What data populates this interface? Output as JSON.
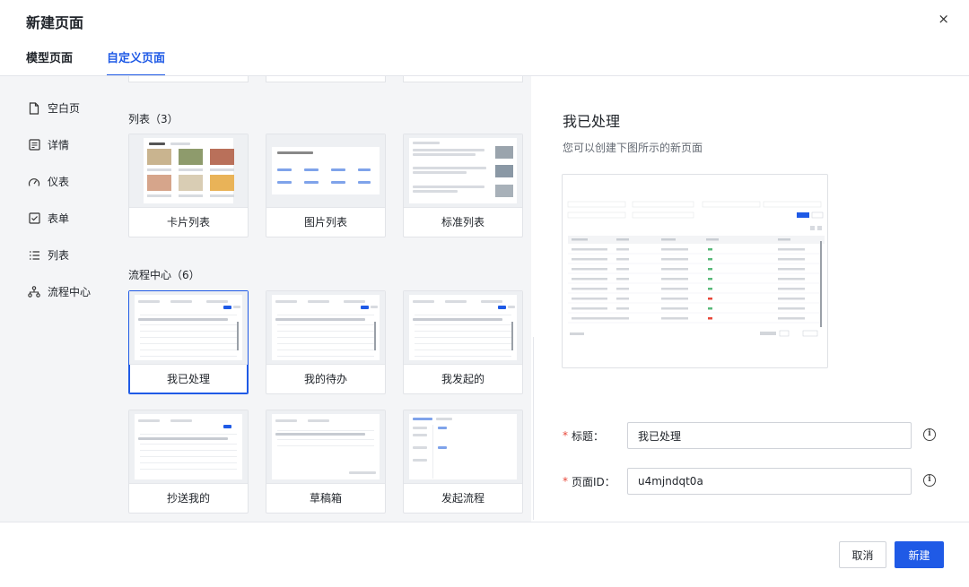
{
  "dialog": {
    "title": "新建页面",
    "close": "×"
  },
  "tabs": [
    {
      "label": "模型页面"
    },
    {
      "label": "自定义页面"
    }
  ],
  "sidebar": {
    "items": [
      {
        "label": "空白页",
        "icon": "file-icon"
      },
      {
        "label": "详情",
        "icon": "detail-icon"
      },
      {
        "label": "仪表",
        "icon": "gauge-icon"
      },
      {
        "label": "表单",
        "icon": "checkbox-icon"
      },
      {
        "label": "列表",
        "icon": "list-icon"
      },
      {
        "label": "流程中心",
        "icon": "flow-icon"
      }
    ]
  },
  "sections": {
    "list": {
      "title": "列表（3）",
      "cards": [
        {
          "label": "卡片列表"
        },
        {
          "label": "图片列表"
        },
        {
          "label": "标准列表"
        }
      ]
    },
    "flow": {
      "title": "流程中心（6）",
      "cards": [
        {
          "label": "我已处理"
        },
        {
          "label": "我的待办"
        },
        {
          "label": "我发起的"
        },
        {
          "label": "抄送我的"
        },
        {
          "label": "草稿箱"
        },
        {
          "label": "发起流程"
        }
      ]
    }
  },
  "preview": {
    "title": "我已处理",
    "subtitle": "您可以创建下图所示的新页面"
  },
  "form": {
    "title_label": "标题：",
    "title_value": "我已处理",
    "pageid_label": "页面ID：",
    "pageid_value": "u4mjndqt0a",
    "required_mark": "*",
    "info_mark": "i"
  },
  "footer": {
    "cancel": "取消",
    "create": "新建"
  },
  "colors": {
    "accent": "#1f5ae6",
    "required": "#e8473a"
  }
}
